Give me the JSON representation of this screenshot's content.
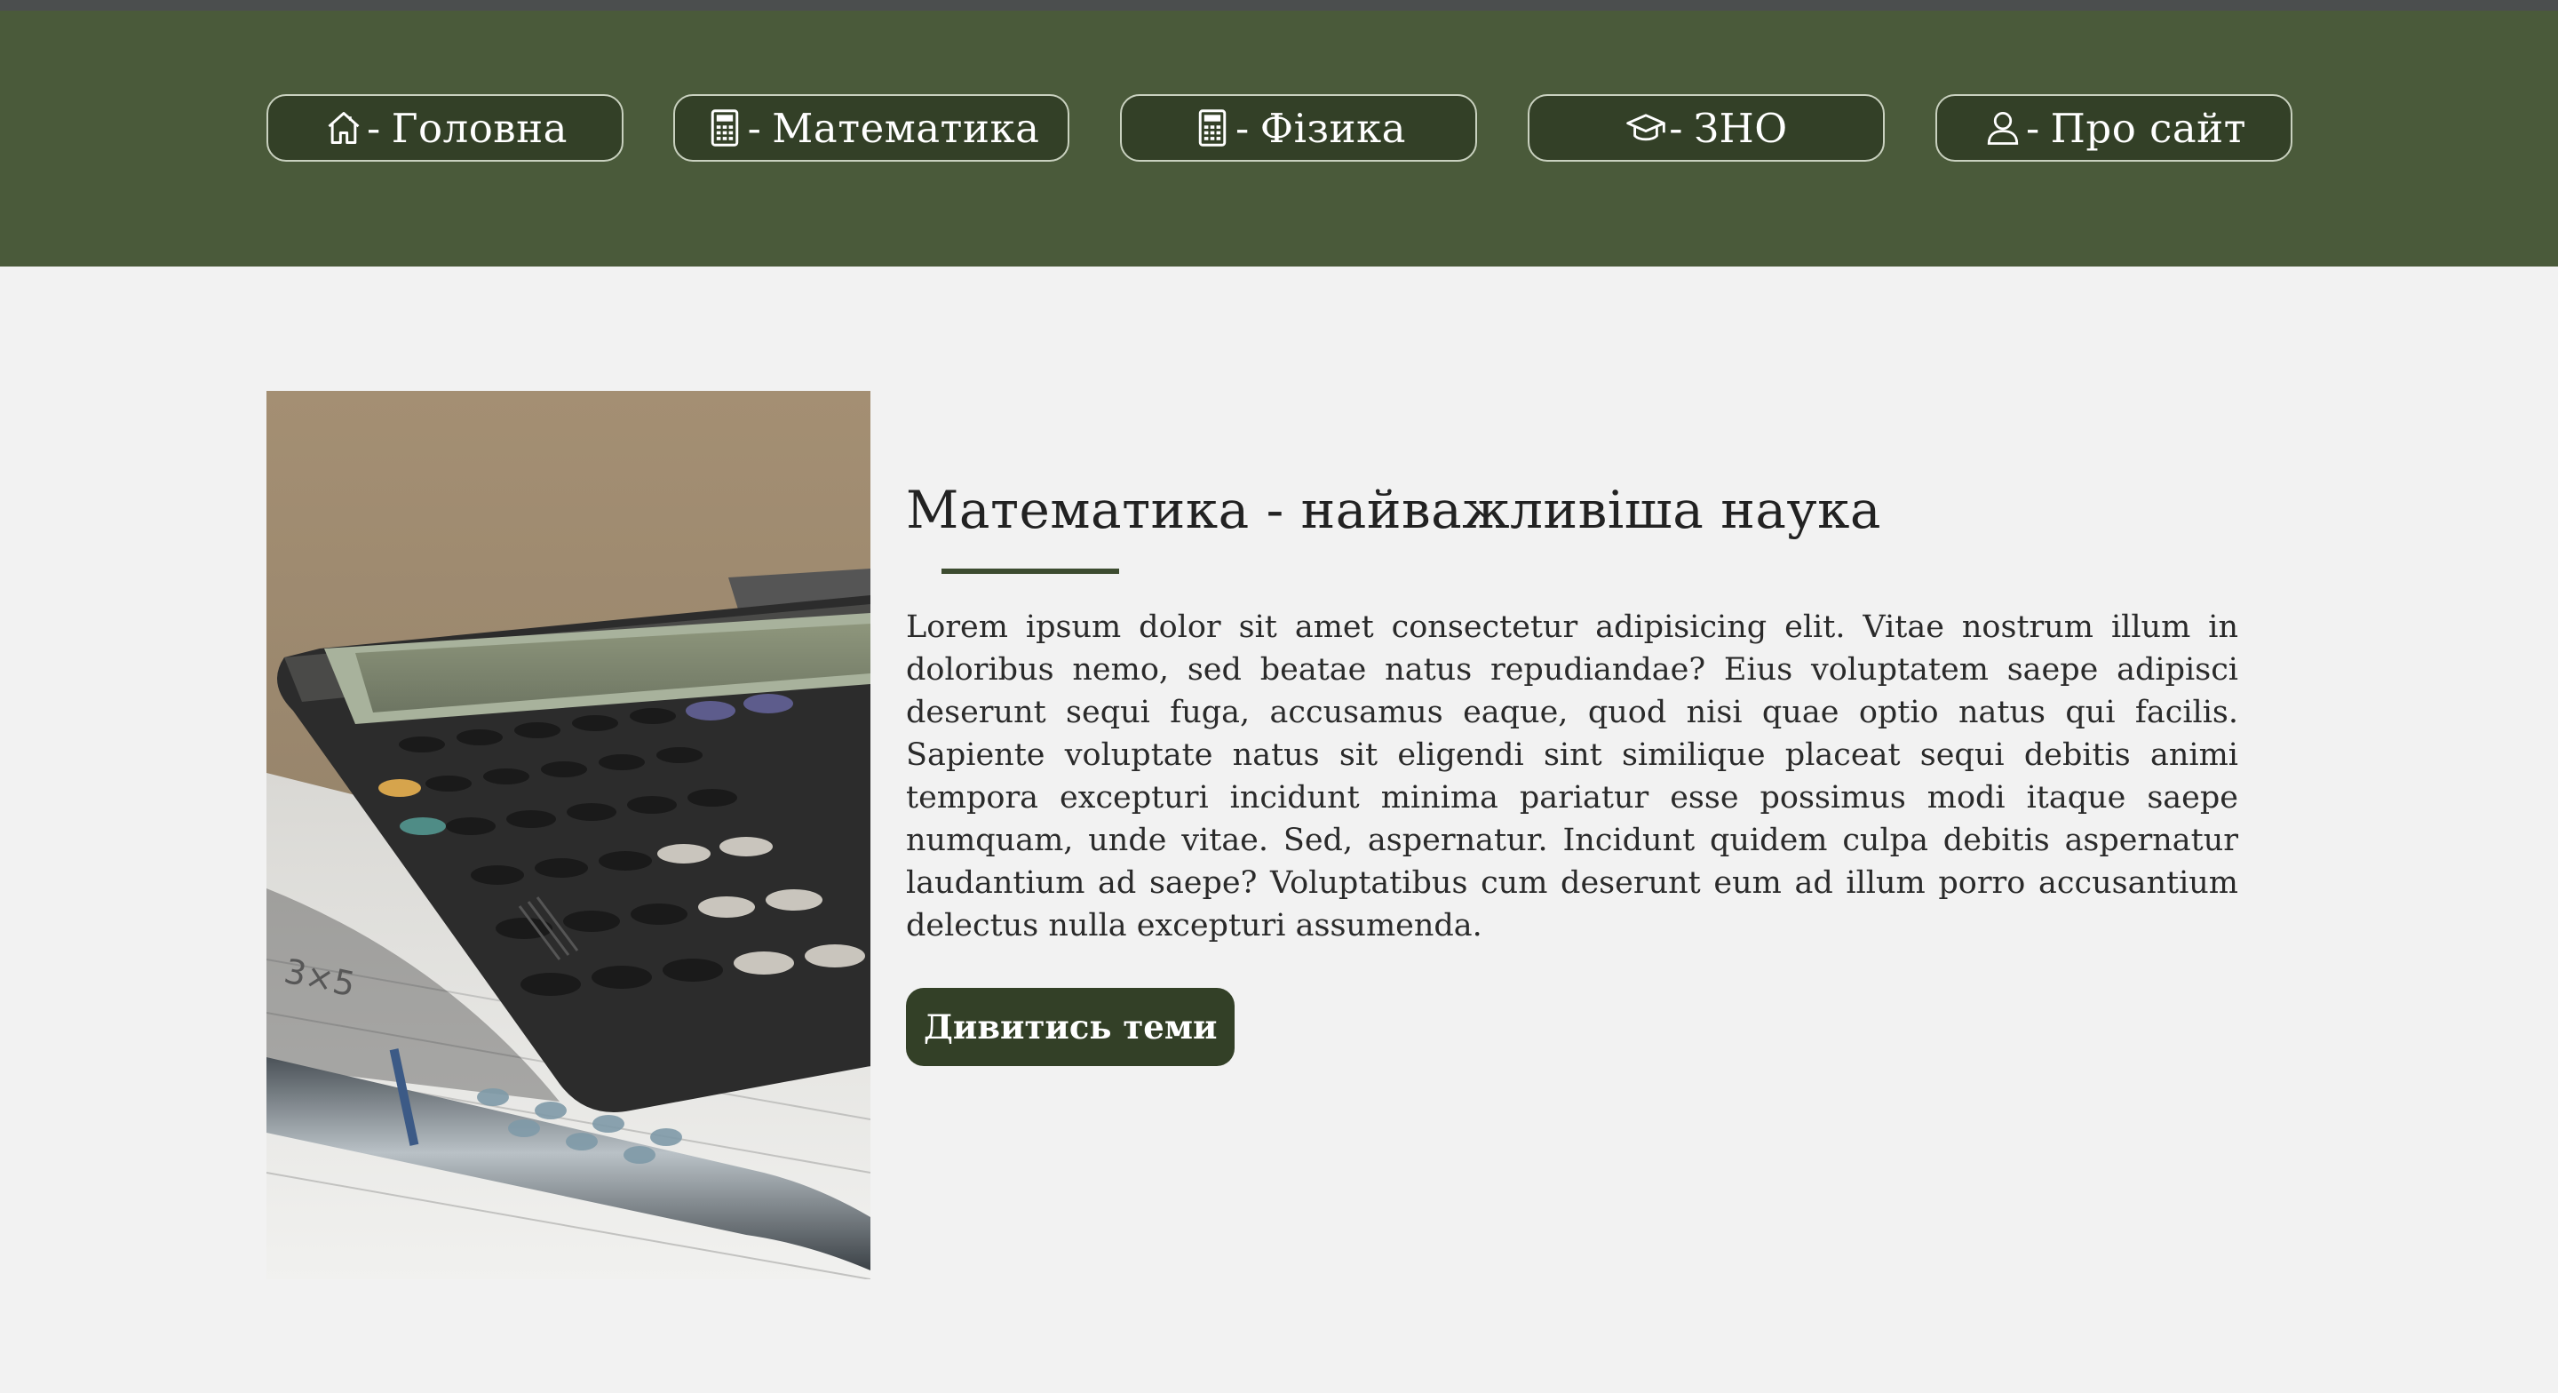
{
  "colors": {
    "header_bg": "#4a5a3a",
    "button_bg": "#334027",
    "page_bg": "#f2f2f2",
    "accent": "#3d4c30"
  },
  "nav": {
    "items": [
      {
        "icon": "home-icon",
        "separator": "-",
        "label": "Головна"
      },
      {
        "icon": "calculator-icon",
        "separator": "-",
        "label": "Математика"
      },
      {
        "icon": "calculator-icon",
        "separator": "-",
        "label": "Фізика"
      },
      {
        "icon": "graduation-cap-icon",
        "separator": "-",
        "label": "ЗНО"
      },
      {
        "icon": "user-icon",
        "separator": "-",
        "label": "Про сайт"
      }
    ]
  },
  "main": {
    "title": "Математика - найважливіша наука",
    "paragraph": "Lorem ipsum dolor sit amet consectetur adipisicing elit. Vitae nostrum illum in doloribus nemo, sed beatae natus repudiandae? Eius voluptatem saepe adipisci deserunt sequi fuga, accusamus eaque, quod nisi quae optio natus qui facilis. Sapiente voluptate natus sit eligendi sint similique placeat sequi debitis animi tempora excepturi incidunt minima pariatur esse possimus modi itaque saepe numquam, unde vitae. Sed, aspernatur. Incidunt quidem culpa debitis aspernatur laudantium ad saepe? Voluptatibus cum deserunt eum ad illum porro accusantium delectus nulla excepturi assumenda.",
    "button_label": "Дивитись теми",
    "image": {
      "subject": "calculator-and-pen-photo",
      "note_text": "3×5"
    }
  }
}
